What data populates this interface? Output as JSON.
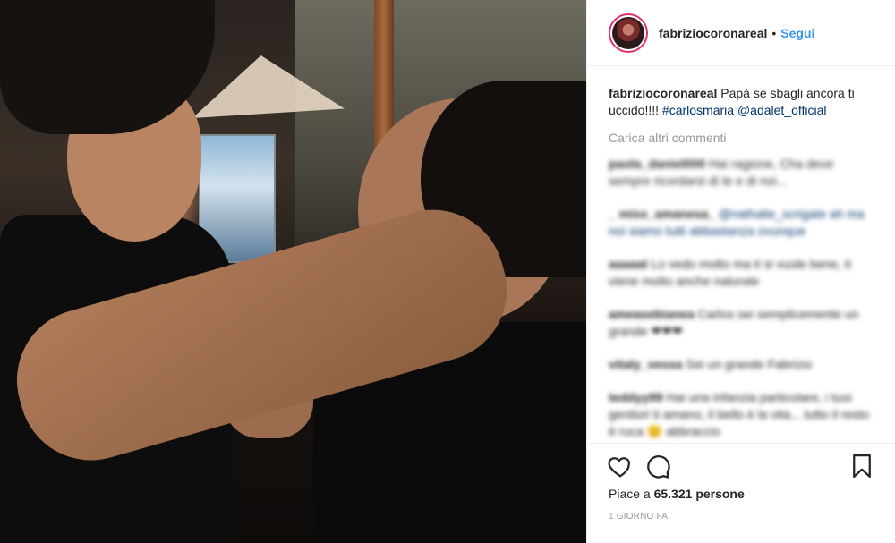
{
  "post": {
    "image_alt": "Photo of a young man holding an older man's chin",
    "username": "fabriziocoronareal",
    "dot": "•",
    "follow_label": "Segui",
    "caption": {
      "user": "fabriziocoronareal",
      "text": "Papà se sbagli ancora ti uccido!!!!",
      "hashtag": "#carlosmaria",
      "mention": "@adalet_official"
    },
    "load_more_label": "Carica altri commenti",
    "blurred_comments": [
      {
        "user": "paola_daniel000",
        "text": "Hai ragione, Cha deve sempre ricordarsi di te e di noi..."
      },
      {
        "user": "_ miss_amanesa_",
        "text": "@nathalie_scrigate ah ma noi siamo tutti abbastanza ovunque"
      },
      {
        "user": "aaaaat",
        "text": "Lo vedo molto ma ti si vuole bene, ti viene molto anche naturale"
      },
      {
        "user": "ameasebianea",
        "text": "Carlos sei semplicemente un grande ❤❤❤"
      },
      {
        "user": "vitaly_vessa",
        "text": "Sei un grande Fabrizio"
      },
      {
        "user": "teddyy99",
        "text": "Hai una infanzia particolare, i tuoi genitori ti amano, il bello è la vita... tutto il resto è ruca 😊 abbraccio"
      }
    ],
    "likes": {
      "prefix": "Piace a",
      "count": "65.321",
      "suffix": "persone"
    },
    "timestamp": "1 giorno fa"
  },
  "icons": {
    "like": "heart-icon",
    "comment": "comment-icon",
    "save": "bookmark-icon"
  },
  "colors": {
    "accent": "#3897f0",
    "link": "#003569",
    "muted": "#999999",
    "text": "#262626"
  }
}
